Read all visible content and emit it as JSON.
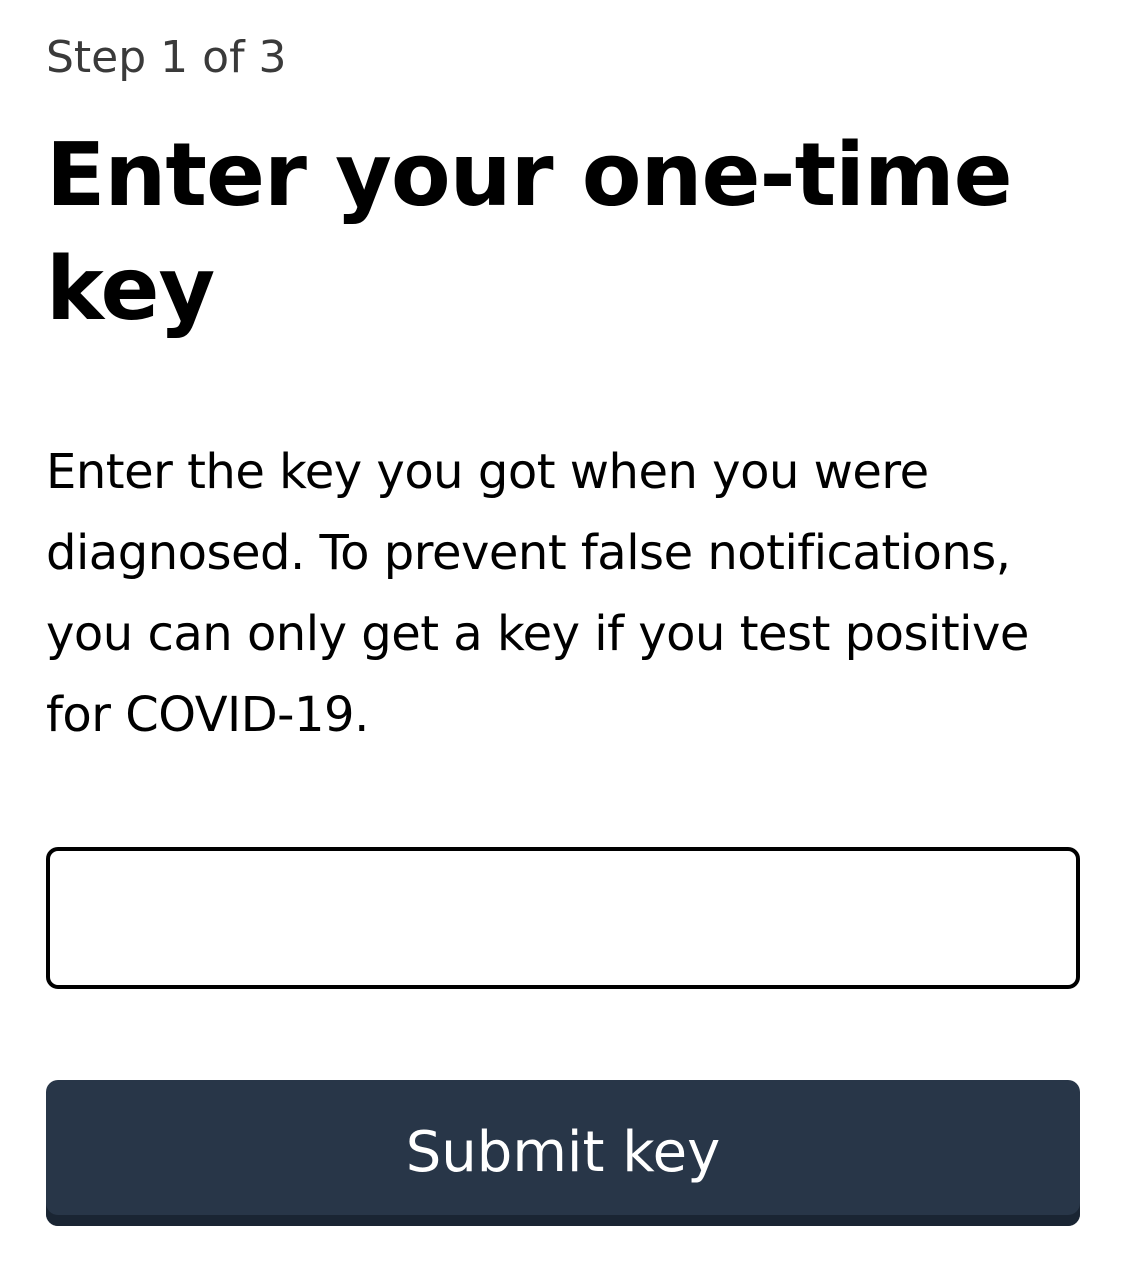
{
  "progress": {
    "step_label": "Step 1 of 3",
    "current_step": 1,
    "total_steps": 3
  },
  "header": {
    "title": "Enter your one-time key"
  },
  "main": {
    "description": "Enter the key you got when you were diagnosed. To prevent false notifications, you can only get a key if you test positive for COVID-19.",
    "key_input": {
      "value": "",
      "placeholder": ""
    },
    "submit_label": "Submit key"
  },
  "colors": {
    "button_background": "#283648",
    "button_text": "#ffffff",
    "input_border": "#000000",
    "step_text": "#3a3a3a"
  }
}
